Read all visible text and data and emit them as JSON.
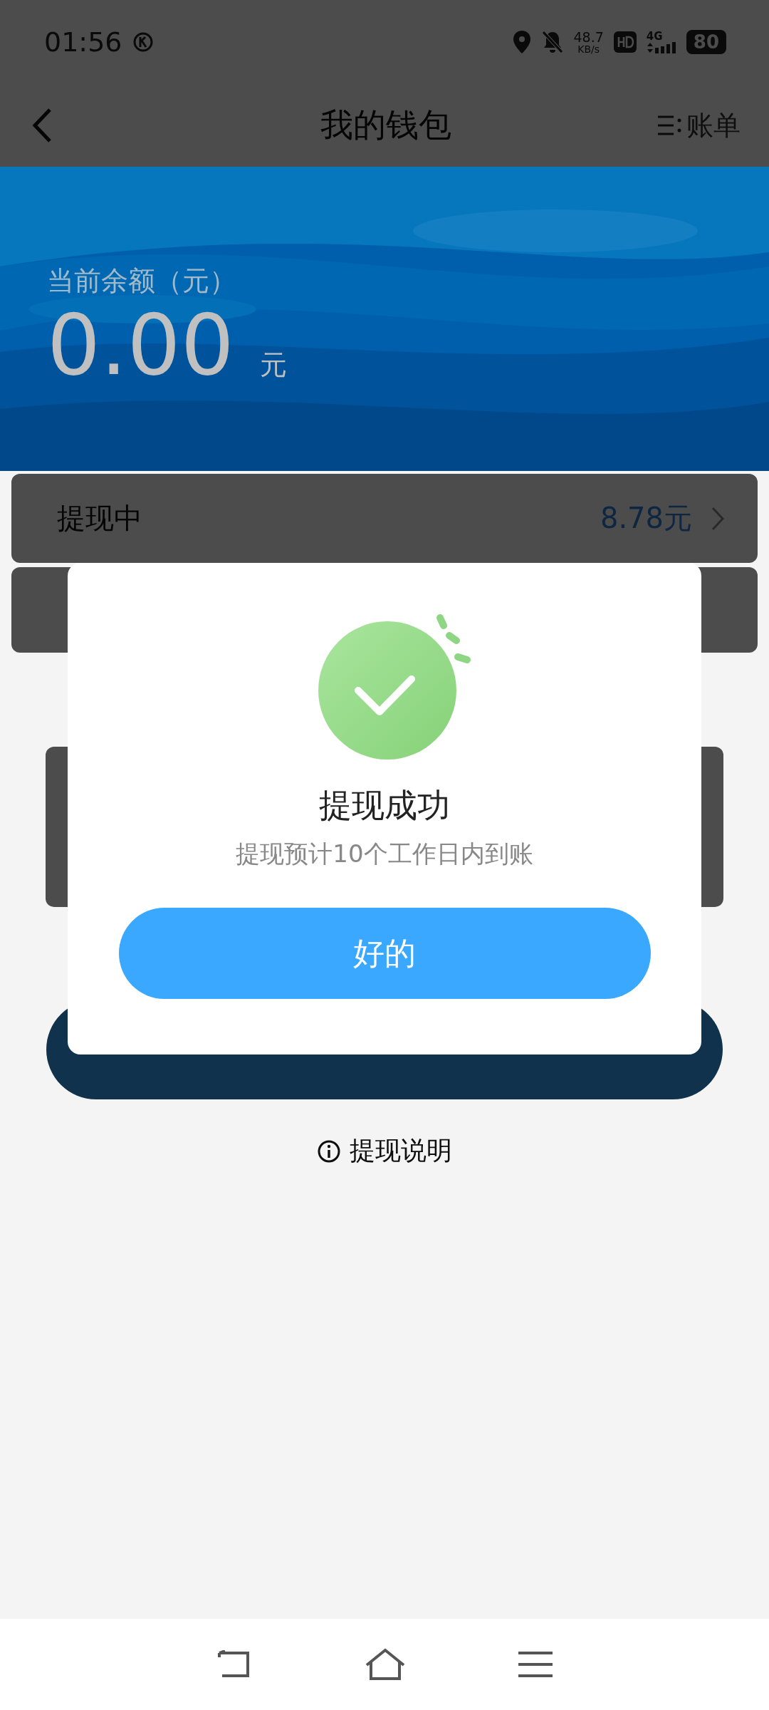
{
  "status_bar": {
    "time": "01:56",
    "speed": "48.7",
    "speed_unit": "KB/s",
    "network": "4G",
    "battery": "80"
  },
  "header": {
    "title": "我的钱包",
    "bill_link": "账单"
  },
  "balance": {
    "label": "当前余额（元）",
    "amount": "0.00",
    "unit": "元"
  },
  "withdrawing": {
    "label": "提现中",
    "amount": "8.78元"
  },
  "help_link": "提现说明",
  "dialog": {
    "title": "提现成功",
    "message": "提现预计10个工作日内到账",
    "button": "好的"
  }
}
